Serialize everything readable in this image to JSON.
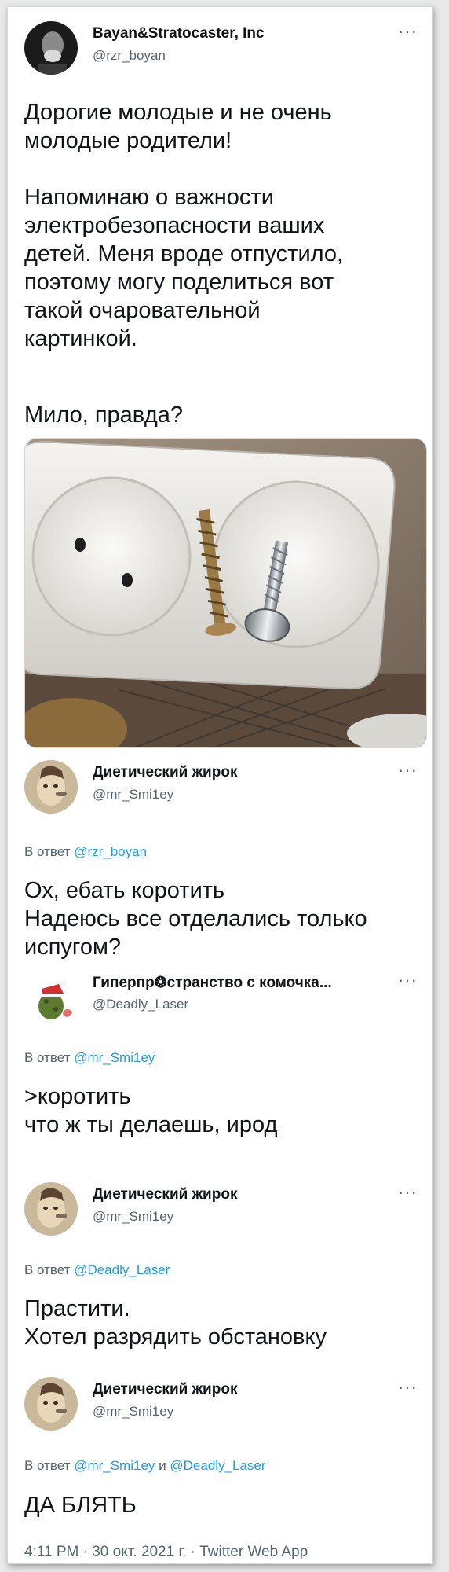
{
  "main_tweet": {
    "display_name": "Bayan&Stratocaster, Inc",
    "handle": "@rzr_boyan",
    "text": "Дорогие молодые и не очень\nмолодые родители!\n\nНапоминаю о важности\nэлектробезопасности ваших\nдетей. Меня вроде отпустило,\nпоэтому могу поделиться вот\nтакой очаровательной\nкартинкой.",
    "text2": "Мило, правда?"
  },
  "replies": [
    {
      "display_name": "Диетический жирок",
      "handle": "@mr_Smi1ey",
      "reply_prefix": "В ответ",
      "reply_to": "@rzr_boyan",
      "text": "Ох, ебать коротить\nНадеюсь все отделались только\nиспугом?"
    },
    {
      "display_name": "Гиперпр❂странство с комочка...",
      "handle": "@Deadly_Laser",
      "reply_prefix": "В ответ",
      "reply_to": "@mr_Smi1ey",
      "text": ">коротить\nчто ж ты делаешь, ирод"
    },
    {
      "display_name": "Диетический жирок",
      "handle": "@mr_Smi1ey",
      "reply_prefix": "В ответ",
      "reply_to": "@Deadly_Laser",
      "text": "Прастити.\nХотел разрядить обстановку"
    },
    {
      "display_name": "Диетический жирок",
      "handle": "@mr_Smi1ey",
      "reply_prefix": "В ответ",
      "reply_to": "@mr_Smi1ey",
      "reply_joiner": "и",
      "reply_to2": "@Deadly_Laser",
      "text": "ДА БЛЯТЬ"
    }
  ],
  "more_label": "···",
  "footer": "4:11 PM · 30 окт. 2021 г. · Twitter Web App",
  "colors": {
    "link": "#1d9bf0",
    "secondary": "#536471",
    "text": "#0f1419"
  },
  "icons": [
    "more-options-icon",
    "avatar"
  ]
}
